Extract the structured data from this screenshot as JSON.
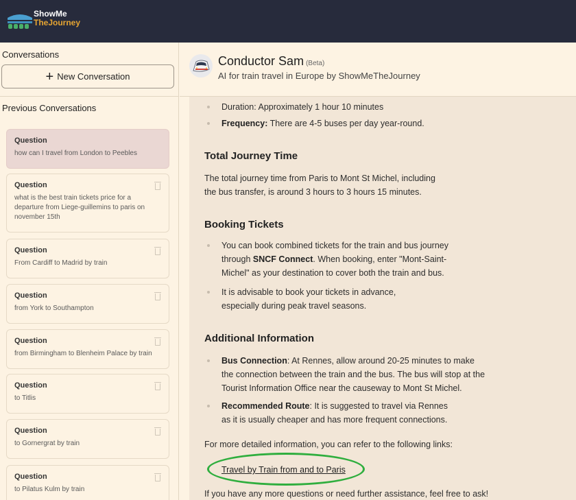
{
  "brand": {
    "line1": "ShowMe",
    "line2": "TheJourney"
  },
  "sidebar": {
    "conversations_label": "Conversations",
    "new_conversation_label": "New Conversation",
    "previous_label": "Previous Conversations",
    "items": [
      {
        "label": "Question",
        "text": "how can I travel from London to Peebles",
        "active": true
      },
      {
        "label": "Question",
        "text": "what is the best train tickets price for a departure from Liege-guillemins to paris on november 15th"
      },
      {
        "label": "Question",
        "text": "From Cardiff to Madrid by train"
      },
      {
        "label": "Question",
        "text": "from York to Southampton"
      },
      {
        "label": "Question",
        "text": "from Birmingham to Blenheim Palace by train"
      },
      {
        "label": "Question",
        "text": "to Titlis"
      },
      {
        "label": "Question",
        "text": "to Gornergrat by train"
      },
      {
        "label": "Question",
        "text": "to Pilatus Kulm by train"
      }
    ]
  },
  "header": {
    "title": "Conductor Sam",
    "beta": "(Beta)",
    "subtitle": "AI for train travel in Europe by ShowMeTheJourney"
  },
  "message": {
    "cut_line": "Duration: Approximately 1 hour 10 minutes",
    "frequency_bold": "Frequency:",
    "frequency_text": " There are 4-5 buses per day year-round.",
    "h_total": "Total Journey Time",
    "total_text": "The total journey time from Paris to Mont St Michel, including the bus transfer, is around 3 hours to 3 hours 15 minutes.",
    "h_booking": "Booking Tickets",
    "booking_1a": "You can book combined tickets for the train and bus journey through ",
    "booking_1b": "SNCF Connect",
    "booking_1c": ". When booking, enter \"Mont-Saint-Michel\" as your destination to cover both the train and bus.",
    "booking_2": "It is advisable to book your tickets in advance, especially during peak travel seasons.",
    "h_additional": "Additional Information",
    "add_1_bold": "Bus Connection",
    "add_1_text": ": At Rennes, allow around 20-25 minutes to make the connection between the train and the bus. The bus will stop at the Tourist Information Office near the causeway to Mont St Michel.",
    "add_2_bold": "Recommended Route",
    "add_2_text": ": It is suggested to travel via Rennes as it is usually cheaper and has more frequent connections.",
    "links_intro": "For more detailed information, you can refer to the following links:",
    "link_text": "Travel by Train from and to Paris",
    "closing": "If you have any more questions or need further assistance, feel free to ask!"
  },
  "colors": {
    "topbar": "#272b3c",
    "accent": "#e6a532",
    "highlight_oval": "#2fae3e",
    "active_card": "#ead7d3"
  }
}
